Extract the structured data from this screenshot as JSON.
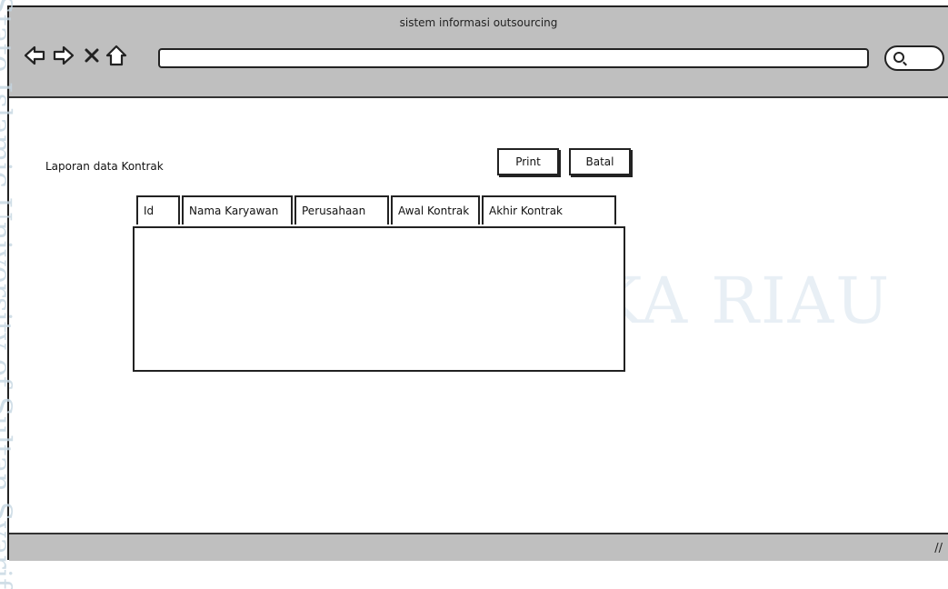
{
  "window": {
    "title": "sistem informasi outsourcing"
  },
  "toolbar": {
    "back_icon": "arrow-left-icon",
    "forward_icon": "arrow-right-icon",
    "close_icon": "x-icon",
    "home_icon": "home-icon",
    "address_value": "",
    "search_icon": "search-icon"
  },
  "page": {
    "report_label": "Laporan data Kontrak",
    "print_label": "Print",
    "batal_label": "Batal"
  },
  "table": {
    "columns": [
      "Id",
      "Nama Karyawan",
      "Perusahaan",
      "Awal Kontrak",
      "Akhir Kontrak"
    ],
    "rows": []
  },
  "watermark": {
    "side": "State Islamic University of Sultan Syarif",
    "center": "UIN SUSKA RIAU"
  },
  "status_bar": {
    "resize_icon": "resize-grip-icon"
  }
}
